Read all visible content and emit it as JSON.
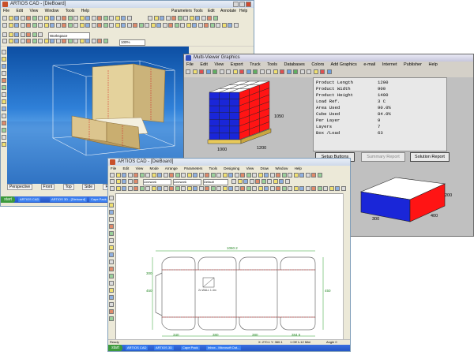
{
  "window_design": {
    "title": "ARTIOS CAD - [DieBoard]",
    "menu": [
      "File",
      "Edit",
      "View",
      "Window",
      "Tools",
      "Help"
    ],
    "right_menu": [
      "Parameters",
      "Tools",
      "Edit",
      "Annotate",
      "Help"
    ],
    "toolbar_field": "Workspace",
    "zoom": "100%",
    "view_tabs": [
      "Perspective",
      "Front",
      "Top",
      "Side",
      "Folding"
    ]
  },
  "window_viewer": {
    "title": "Multi-Viewer Graphics",
    "menu": [
      "File",
      "Edit",
      "View",
      "Export",
      "Truck",
      "Tools",
      "Databases",
      "Colors",
      "Add Graphics",
      "e-mail",
      "Internet",
      "Publisher",
      "Help"
    ],
    "pallet_labels": {
      "height": "1050",
      "width": "1200",
      "length": "1000"
    },
    "info": [
      {
        "label": "Product Length",
        "value": "1200"
      },
      {
        "label": "Product Width",
        "value": "900"
      },
      {
        "label": "Product Height",
        "value": "1400"
      },
      {
        "label": "Load Ref.",
        "value": "3 C"
      },
      {
        "label": "Area Used",
        "value": "90.0%"
      },
      {
        "label": "Cube Used",
        "value": "84.0%"
      },
      {
        "label": "Per Layer",
        "value": "9"
      },
      {
        "label": "Layers",
        "value": "7"
      },
      {
        "label": "Box /Load",
        "value": "63"
      }
    ],
    "buttons": {
      "setup": "Setup Buttons",
      "summary": "Summary Report",
      "solution": "Solution Report"
    },
    "box_labels": {
      "height": "200",
      "length": "400",
      "width": "300"
    }
  },
  "window_carton": {
    "title": "ARTIOS CAD - [DieBoard]",
    "menu": [
      "File",
      "Edit",
      "View",
      "Mode",
      "Arrange",
      "Parameters",
      "Tools",
      "Designing",
      "View",
      "Draw",
      "Window",
      "Help"
    ],
    "field_values": [
      "Linework",
      "Linework",
      "Default"
    ],
    "dims": {
      "overall": "1060.2",
      "left_height": "300",
      "mid_height": "450",
      "panels": [
        "340",
        "380",
        "380",
        "384.5"
      ],
      "right": "450",
      "label": "2x WALL 1.4m"
    },
    "status": {
      "ready": "Ready",
      "coords1": "X: 270.1  Y: 360.1",
      "coords2": "1 Off  1-12 Mini",
      "zoom": "Angle  0"
    }
  },
  "taskbar": {
    "start": "start",
    "tasks_top": [
      "ARTIOS CAD",
      "ARTIOS 3D - [Dieboard]",
      "Cape Pack - Multi-Viewer"
    ],
    "tasks_bottom": [
      "ARTIOS CAD",
      "ARTIOS 3D",
      "Cape Pack",
      "Inbox - Microsoft Out..."
    ]
  },
  "colors": {
    "box_blue": "#1a26d8",
    "box_red": "#ff1414",
    "carton": "#d9c89a",
    "sky": "#2f80d8"
  }
}
